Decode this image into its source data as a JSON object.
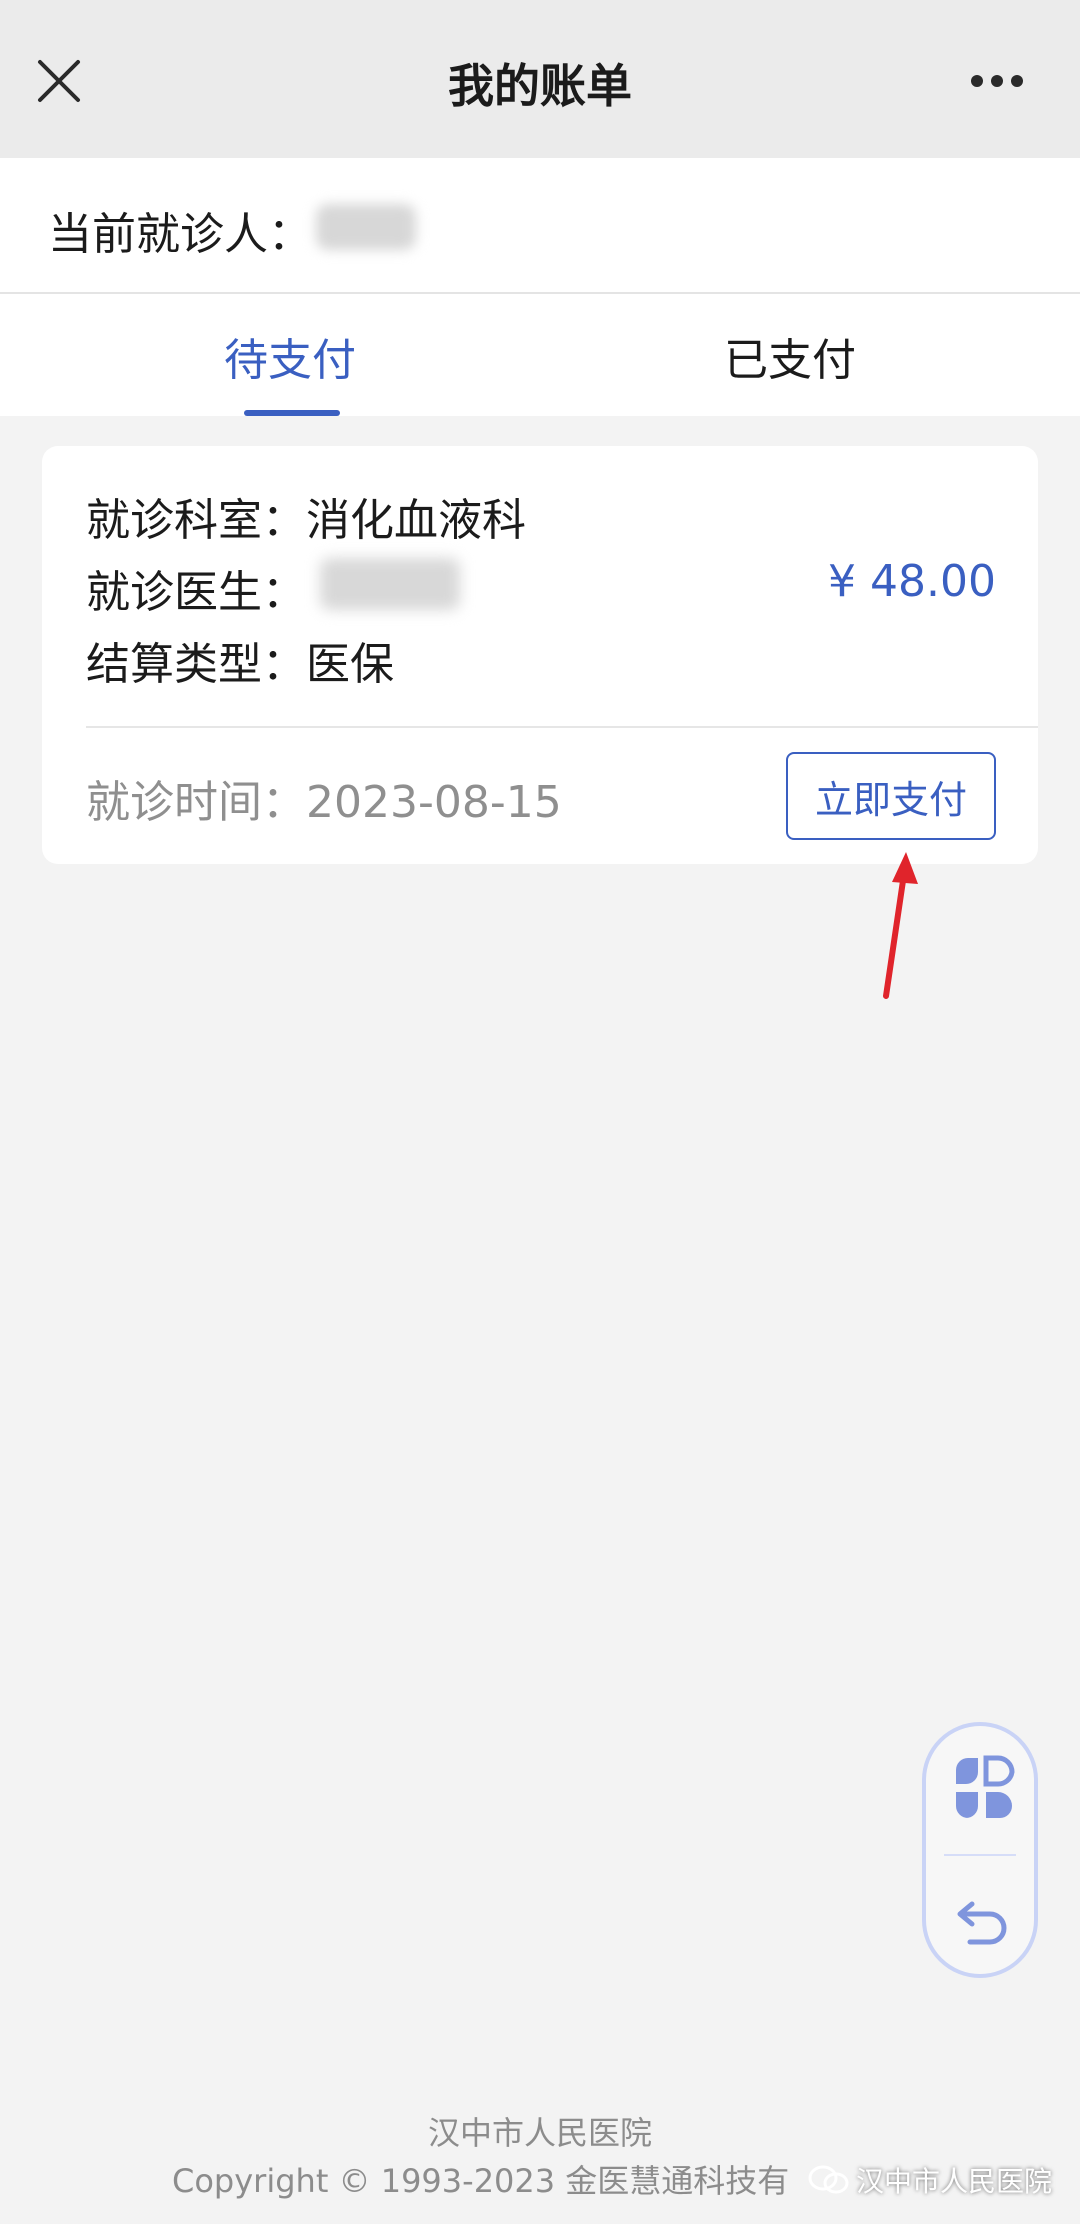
{
  "header": {
    "title": "我的账单",
    "close_icon": "close-icon",
    "more_icon": "more-icon"
  },
  "patient": {
    "label": "当前就诊人："
  },
  "tabs": [
    {
      "label": "待支付",
      "active": true
    },
    {
      "label": "已支付",
      "active": false
    }
  ],
  "bill": {
    "department_label": "就诊科室：",
    "department_value": "消化血液科",
    "doctor_label": "就诊医生：",
    "settlement_label": "结算类型：",
    "settlement_value": "医保",
    "amount": "¥ 48.00",
    "time_label": "就诊时间：",
    "time_value": "2023-08-15",
    "pay_button": "立即支付"
  },
  "floating": {
    "top_icon": "apps-grid-icon",
    "bottom_icon": "back-arrow-icon"
  },
  "footer": {
    "hospital": "汉中市人民医院",
    "copyright": "Copyright © 1993-2023 金医慧通科技有"
  },
  "watermark": {
    "text": "汉中市人民医院"
  },
  "colors": {
    "accent": "#3a5fc1",
    "annotation": "#e0242b"
  }
}
